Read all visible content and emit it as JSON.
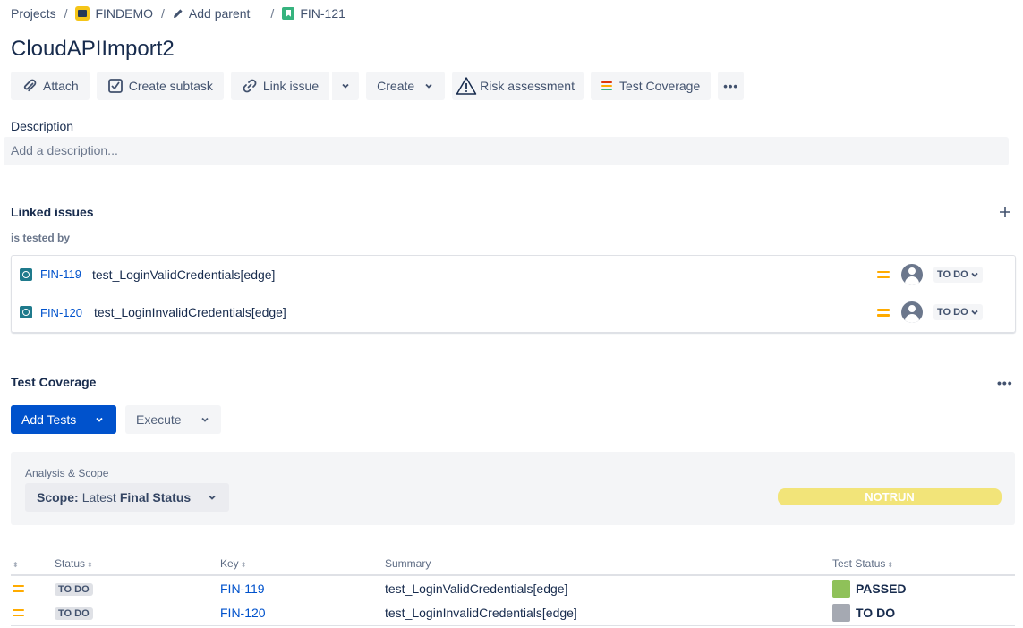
{
  "breadcrumb": {
    "projects": "Projects",
    "project": "FINDEMO",
    "add_parent": "Add parent",
    "issue_key": "FIN-121",
    "separator": "/"
  },
  "issue": {
    "title": "CloudAPIImport2"
  },
  "toolbar": {
    "attach": "Attach",
    "create_subtask": "Create subtask",
    "link_issue": "Link issue",
    "create": "Create",
    "risk_assessment": "Risk assessment",
    "test_coverage": "Test Coverage",
    "more": "•••"
  },
  "description": {
    "label": "Description",
    "placeholder": "Add a description..."
  },
  "linked_issues": {
    "label": "Linked issues",
    "relation": "is tested by",
    "items": [
      {
        "key": "FIN-119",
        "summary": "test_LoginValidCredentials[edge]",
        "status": "TO DO",
        "priority_icon": "medium-priority-icon"
      },
      {
        "key": "FIN-120",
        "summary": "test_LoginInvalidCredentials[edge]",
        "status": "TO DO",
        "priority_icon": "medium-priority-icon"
      }
    ]
  },
  "test_coverage": {
    "label": "Test Coverage",
    "more": "•••",
    "add_tests": "Add Tests",
    "execute": "Execute",
    "analysis_title": "Analysis & Scope",
    "scope_label": "Scope:",
    "scope_value_prefix": "Latest",
    "scope_value_bold": "Final Status",
    "overall_status": "NOTRUN",
    "columns": {
      "status": "Status",
      "key": "Key",
      "summary": "Summary",
      "test_status": "Test Status"
    },
    "rows": [
      {
        "status": "TO DO",
        "key": "FIN-119",
        "summary": "test_LoginValidCredentials[edge]",
        "test_status": "PASSED",
        "test_status_color": "#8fc159"
      },
      {
        "status": "TO DO",
        "key": "FIN-120",
        "summary": "test_LoginInvalidCredentials[edge]",
        "test_status": "TO DO",
        "test_status_color": "#a5a9b2"
      }
    ]
  },
  "colors": {
    "primary": "#0052cc",
    "notrun_bar": "#f2e479",
    "priority_medium": "#ffab00"
  }
}
